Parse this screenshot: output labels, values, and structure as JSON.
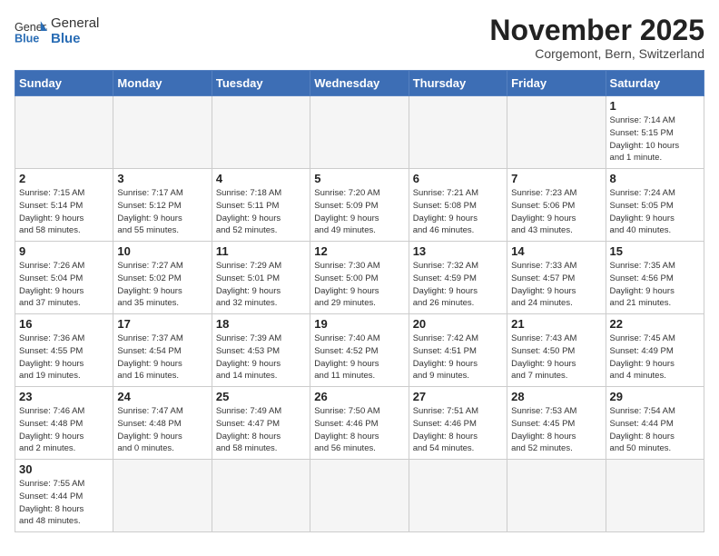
{
  "header": {
    "logo_general": "General",
    "logo_blue": "Blue",
    "month_title": "November 2025",
    "location": "Corgemont, Bern, Switzerland"
  },
  "days_of_week": [
    "Sunday",
    "Monday",
    "Tuesday",
    "Wednesday",
    "Thursday",
    "Friday",
    "Saturday"
  ],
  "weeks": [
    [
      {
        "day": "",
        "info": ""
      },
      {
        "day": "",
        "info": ""
      },
      {
        "day": "",
        "info": ""
      },
      {
        "day": "",
        "info": ""
      },
      {
        "day": "",
        "info": ""
      },
      {
        "day": "",
        "info": ""
      },
      {
        "day": "1",
        "info": "Sunrise: 7:14 AM\nSunset: 5:15 PM\nDaylight: 10 hours\nand 1 minute."
      }
    ],
    [
      {
        "day": "2",
        "info": "Sunrise: 7:15 AM\nSunset: 5:14 PM\nDaylight: 9 hours\nand 58 minutes."
      },
      {
        "day": "3",
        "info": "Sunrise: 7:17 AM\nSunset: 5:12 PM\nDaylight: 9 hours\nand 55 minutes."
      },
      {
        "day": "4",
        "info": "Sunrise: 7:18 AM\nSunset: 5:11 PM\nDaylight: 9 hours\nand 52 minutes."
      },
      {
        "day": "5",
        "info": "Sunrise: 7:20 AM\nSunset: 5:09 PM\nDaylight: 9 hours\nand 49 minutes."
      },
      {
        "day": "6",
        "info": "Sunrise: 7:21 AM\nSunset: 5:08 PM\nDaylight: 9 hours\nand 46 minutes."
      },
      {
        "day": "7",
        "info": "Sunrise: 7:23 AM\nSunset: 5:06 PM\nDaylight: 9 hours\nand 43 minutes."
      },
      {
        "day": "8",
        "info": "Sunrise: 7:24 AM\nSunset: 5:05 PM\nDaylight: 9 hours\nand 40 minutes."
      }
    ],
    [
      {
        "day": "9",
        "info": "Sunrise: 7:26 AM\nSunset: 5:04 PM\nDaylight: 9 hours\nand 37 minutes."
      },
      {
        "day": "10",
        "info": "Sunrise: 7:27 AM\nSunset: 5:02 PM\nDaylight: 9 hours\nand 35 minutes."
      },
      {
        "day": "11",
        "info": "Sunrise: 7:29 AM\nSunset: 5:01 PM\nDaylight: 9 hours\nand 32 minutes."
      },
      {
        "day": "12",
        "info": "Sunrise: 7:30 AM\nSunset: 5:00 PM\nDaylight: 9 hours\nand 29 minutes."
      },
      {
        "day": "13",
        "info": "Sunrise: 7:32 AM\nSunset: 4:59 PM\nDaylight: 9 hours\nand 26 minutes."
      },
      {
        "day": "14",
        "info": "Sunrise: 7:33 AM\nSunset: 4:57 PM\nDaylight: 9 hours\nand 24 minutes."
      },
      {
        "day": "15",
        "info": "Sunrise: 7:35 AM\nSunset: 4:56 PM\nDaylight: 9 hours\nand 21 minutes."
      }
    ],
    [
      {
        "day": "16",
        "info": "Sunrise: 7:36 AM\nSunset: 4:55 PM\nDaylight: 9 hours\nand 19 minutes."
      },
      {
        "day": "17",
        "info": "Sunrise: 7:37 AM\nSunset: 4:54 PM\nDaylight: 9 hours\nand 16 minutes."
      },
      {
        "day": "18",
        "info": "Sunrise: 7:39 AM\nSunset: 4:53 PM\nDaylight: 9 hours\nand 14 minutes."
      },
      {
        "day": "19",
        "info": "Sunrise: 7:40 AM\nSunset: 4:52 PM\nDaylight: 9 hours\nand 11 minutes."
      },
      {
        "day": "20",
        "info": "Sunrise: 7:42 AM\nSunset: 4:51 PM\nDaylight: 9 hours\nand 9 minutes."
      },
      {
        "day": "21",
        "info": "Sunrise: 7:43 AM\nSunset: 4:50 PM\nDaylight: 9 hours\nand 7 minutes."
      },
      {
        "day": "22",
        "info": "Sunrise: 7:45 AM\nSunset: 4:49 PM\nDaylight: 9 hours\nand 4 minutes."
      }
    ],
    [
      {
        "day": "23",
        "info": "Sunrise: 7:46 AM\nSunset: 4:48 PM\nDaylight: 9 hours\nand 2 minutes."
      },
      {
        "day": "24",
        "info": "Sunrise: 7:47 AM\nSunset: 4:48 PM\nDaylight: 9 hours\nand 0 minutes."
      },
      {
        "day": "25",
        "info": "Sunrise: 7:49 AM\nSunset: 4:47 PM\nDaylight: 8 hours\nand 58 minutes."
      },
      {
        "day": "26",
        "info": "Sunrise: 7:50 AM\nSunset: 4:46 PM\nDaylight: 8 hours\nand 56 minutes."
      },
      {
        "day": "27",
        "info": "Sunrise: 7:51 AM\nSunset: 4:46 PM\nDaylight: 8 hours\nand 54 minutes."
      },
      {
        "day": "28",
        "info": "Sunrise: 7:53 AM\nSunset: 4:45 PM\nDaylight: 8 hours\nand 52 minutes."
      },
      {
        "day": "29",
        "info": "Sunrise: 7:54 AM\nSunset: 4:44 PM\nDaylight: 8 hours\nand 50 minutes."
      }
    ],
    [
      {
        "day": "30",
        "info": "Sunrise: 7:55 AM\nSunset: 4:44 PM\nDaylight: 8 hours\nand 48 minutes."
      },
      {
        "day": "",
        "info": ""
      },
      {
        "day": "",
        "info": ""
      },
      {
        "day": "",
        "info": ""
      },
      {
        "day": "",
        "info": ""
      },
      {
        "day": "",
        "info": ""
      },
      {
        "day": "",
        "info": ""
      }
    ]
  ]
}
